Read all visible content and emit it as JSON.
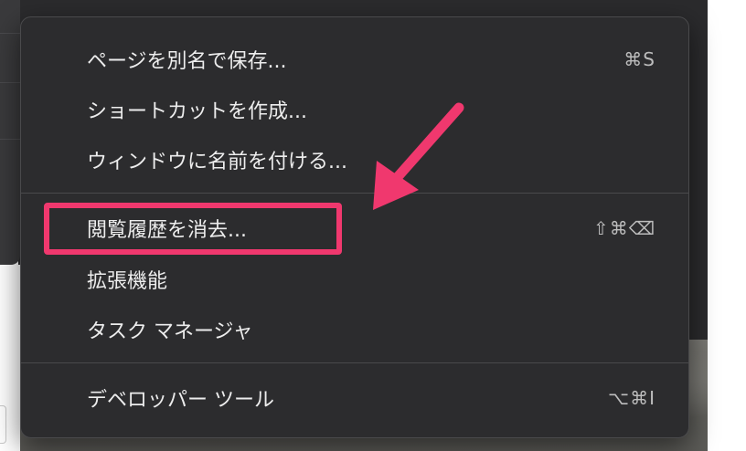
{
  "menu": {
    "items": [
      {
        "label": "ページを別名で保存...",
        "shortcut": "⌘S"
      },
      {
        "label": "ショートカットを作成...",
        "shortcut": ""
      },
      {
        "label": "ウィンドウに名前を付ける...",
        "shortcut": ""
      },
      {
        "label": "閲覧履歴を消去...",
        "shortcut": "⇧⌘⌫"
      },
      {
        "label": "拡張機能",
        "shortcut": ""
      },
      {
        "label": "タスク マネージャ",
        "shortcut": ""
      },
      {
        "label": "デベロッパー ツール",
        "shortcut": "⌥⌘I"
      }
    ]
  },
  "colors": {
    "menu_bg": "#2c2c2e",
    "menu_text": "#ededed",
    "annotation": "#f0386e"
  }
}
